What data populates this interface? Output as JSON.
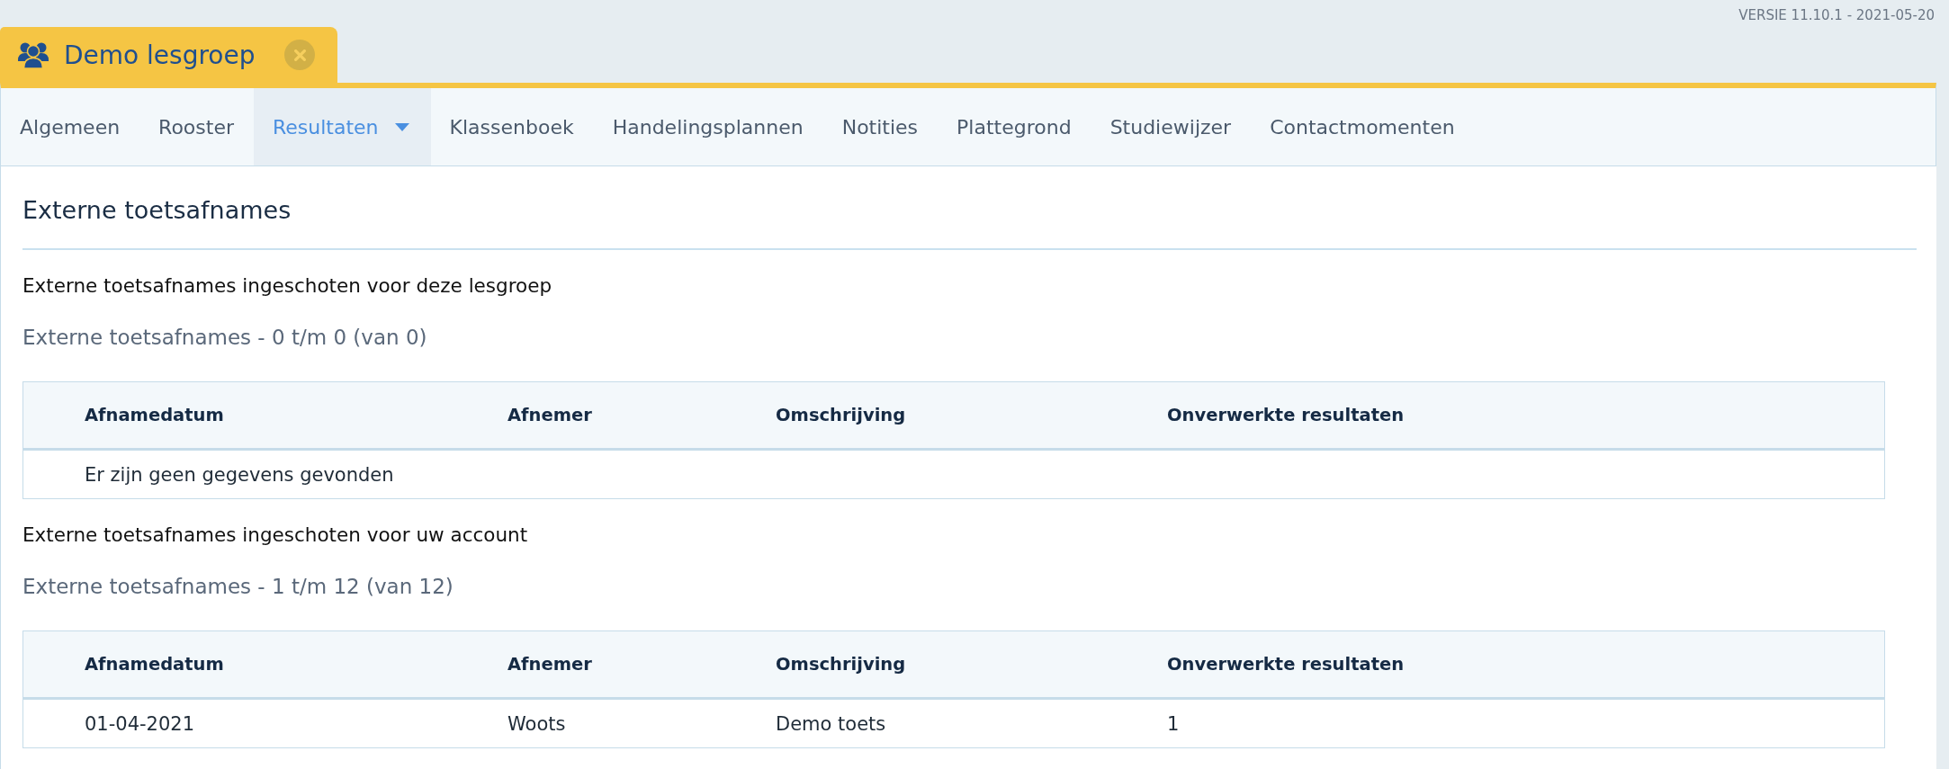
{
  "version": "VERSIE 11.10.1 - 2021-05-20",
  "tab": {
    "title": "Demo lesgroep"
  },
  "nav": [
    {
      "label": "Algemeen",
      "selected": false,
      "has_menu": false
    },
    {
      "label": "Rooster",
      "selected": false,
      "has_menu": false
    },
    {
      "label": "Resultaten",
      "selected": true,
      "has_menu": true
    },
    {
      "label": "Klassenboek",
      "selected": false,
      "has_menu": false
    },
    {
      "label": "Handelingsplannen",
      "selected": false,
      "has_menu": false
    },
    {
      "label": "Notities",
      "selected": false,
      "has_menu": false
    },
    {
      "label": "Plattegrond",
      "selected": false,
      "has_menu": false
    },
    {
      "label": "Studiewijzer",
      "selected": false,
      "has_menu": false
    },
    {
      "label": "Contactmomenten",
      "selected": false,
      "has_menu": false
    }
  ],
  "content": {
    "title": "Externe toetsafnames",
    "sections": [
      {
        "caption": "Externe toetsafnames ingeschoten voor deze lesgroep",
        "summary": "Externe toetsafnames - 0 t/m 0 (van 0)",
        "table": {
          "columns": [
            "Afnamedatum",
            "Afnemer",
            "Omschrijving",
            "Onverwerkte resultaten"
          ],
          "empty_message": "Er zijn geen gegevens gevonden"
        }
      },
      {
        "caption": "Externe toetsafnames ingeschoten voor uw account",
        "summary": "Externe toetsafnames - 1 t/m 12 (van 12)",
        "table": {
          "columns": [
            "Afnamedatum",
            "Afnemer",
            "Omschrijving",
            "Onverwerkte resultaten"
          ],
          "rows": [
            [
              "01-04-2021",
              "Woots",
              "Demo toets",
              "1"
            ]
          ]
        }
      }
    ]
  }
}
